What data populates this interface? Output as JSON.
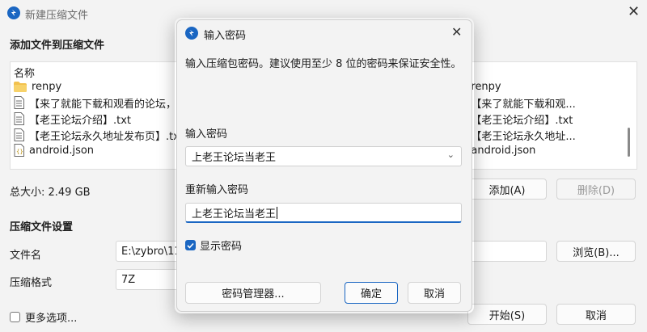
{
  "window": {
    "title": "新建压缩文件",
    "section_add": "添加文件到压缩文件",
    "list_header": "名称",
    "items": [
      {
        "name": "renpy",
        "type": "folder"
      },
      {
        "name": "【来了就能下载和观看的论坛，纯",
        "type": "file"
      },
      {
        "name": "【老王论坛介绍】.txt",
        "type": "file"
      },
      {
        "name": "【老王论坛永久地址发布页】.txt",
        "type": "file"
      },
      {
        "name": "android.json",
        "type": "json"
      }
    ],
    "right_items": [
      "\\renpy",
      "\\【来了就能下载和观...",
      "\\【老王论坛介绍】.txt",
      "\\【老王论坛永久地址...",
      "\\android.json"
    ],
    "total_size": "总大小: 2.49 GB",
    "add_button": "添加(A)",
    "delete_button": "删除(D)",
    "section_settings": "压缩文件设置",
    "filename_label": "文件名",
    "filename_value": "E:\\zybro\\11S",
    "browse_button": "浏览(B)...",
    "format_label": "压缩格式",
    "format_value": "7Z",
    "more_options": "更多选项...",
    "start_button": "开始(S)",
    "cancel_button": "取消"
  },
  "dialog": {
    "title": "输入密码",
    "description": "输入压缩包密码。建议使用至少 8 位的密码来保证安全性。",
    "password_label": "输入密码",
    "password_value": "上老王论坛当老王",
    "reenter_label": "重新输入密码",
    "reenter_value": "上老王论坛当老王",
    "show_password_label": "显示密码",
    "show_password_checked": true,
    "manager_button": "密码管理器...",
    "ok_button": "确定",
    "cancel_button": "取消"
  },
  "colors": {
    "accent": "#1a66c2",
    "folder": "#f2c14e",
    "background": "#f3f3f3"
  }
}
